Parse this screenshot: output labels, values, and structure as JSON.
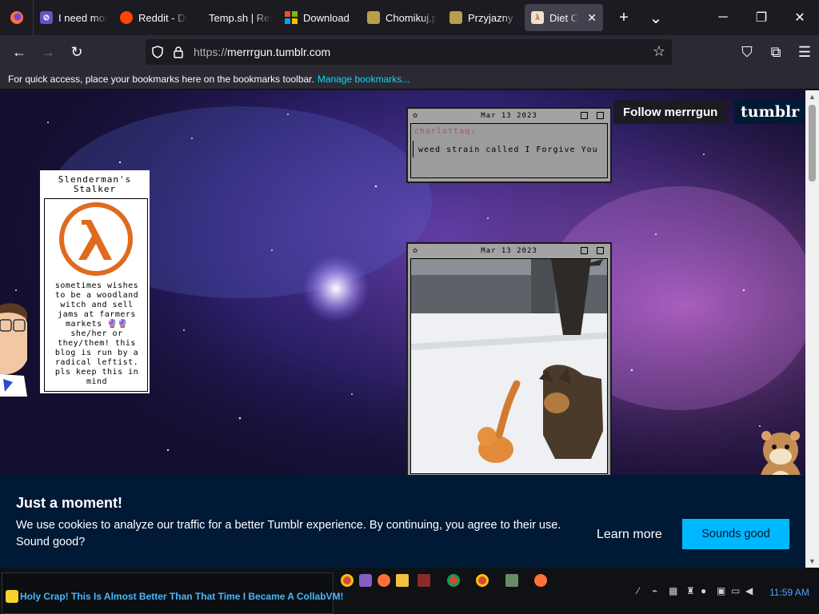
{
  "browser": {
    "tabs": [
      {
        "label": "",
        "active": false
      },
      {
        "label": "I need mor",
        "active": false
      },
      {
        "label": "Reddit - Di",
        "active": false
      },
      {
        "label": "Temp.sh | Retro",
        "active": false
      },
      {
        "label": "Download",
        "active": false
      },
      {
        "label": "Chomikuj.p",
        "active": false
      },
      {
        "label": "Przyjazny d",
        "active": false
      },
      {
        "label": "Diet Cok",
        "active": true
      }
    ],
    "new_tab": "+",
    "list_tabs": "⌄",
    "close_tab": "✕",
    "url_scheme": "https://",
    "url_host": "merrrgun.tumblr.com",
    "bookmarks_msg": "For quick access, place your bookmarks here on the bookmarks toolbar.",
    "bookmarks_link": "Manage bookmarks..."
  },
  "page": {
    "follow_label": "Follow merrrgun",
    "tumblr_label": "tumblr",
    "profile": {
      "name": "Slenderman's Stalker",
      "bio": "sometimes wishes to be a woodland witch and sell jams at farmers markets 🔮🔮 she/her or they/them! this blog is run by a radical leftist. pls keep this in mind"
    },
    "posts": [
      {
        "date": "Mar 13 2023",
        "user": "charlottaq:",
        "text": "weed strain called I Forgive You"
      },
      {
        "date": "Mar 13 2023"
      }
    ]
  },
  "cookie": {
    "title": "Just a moment!",
    "text": "We use cookies to analyze our traffic for a better Tumblr experience. By continuing, you agree to their use. Sound good?",
    "learn_more": "Learn more",
    "accept": "Sounds good"
  },
  "taskbar": {
    "marquee": "Holy Crap! This Is Almost Better Than That Time I Became A CollabVM!",
    "clock": "11:59 AM"
  },
  "colors": {
    "accent": "#00b8ff",
    "banner": "#001935",
    "tab_active": "#42414d"
  }
}
